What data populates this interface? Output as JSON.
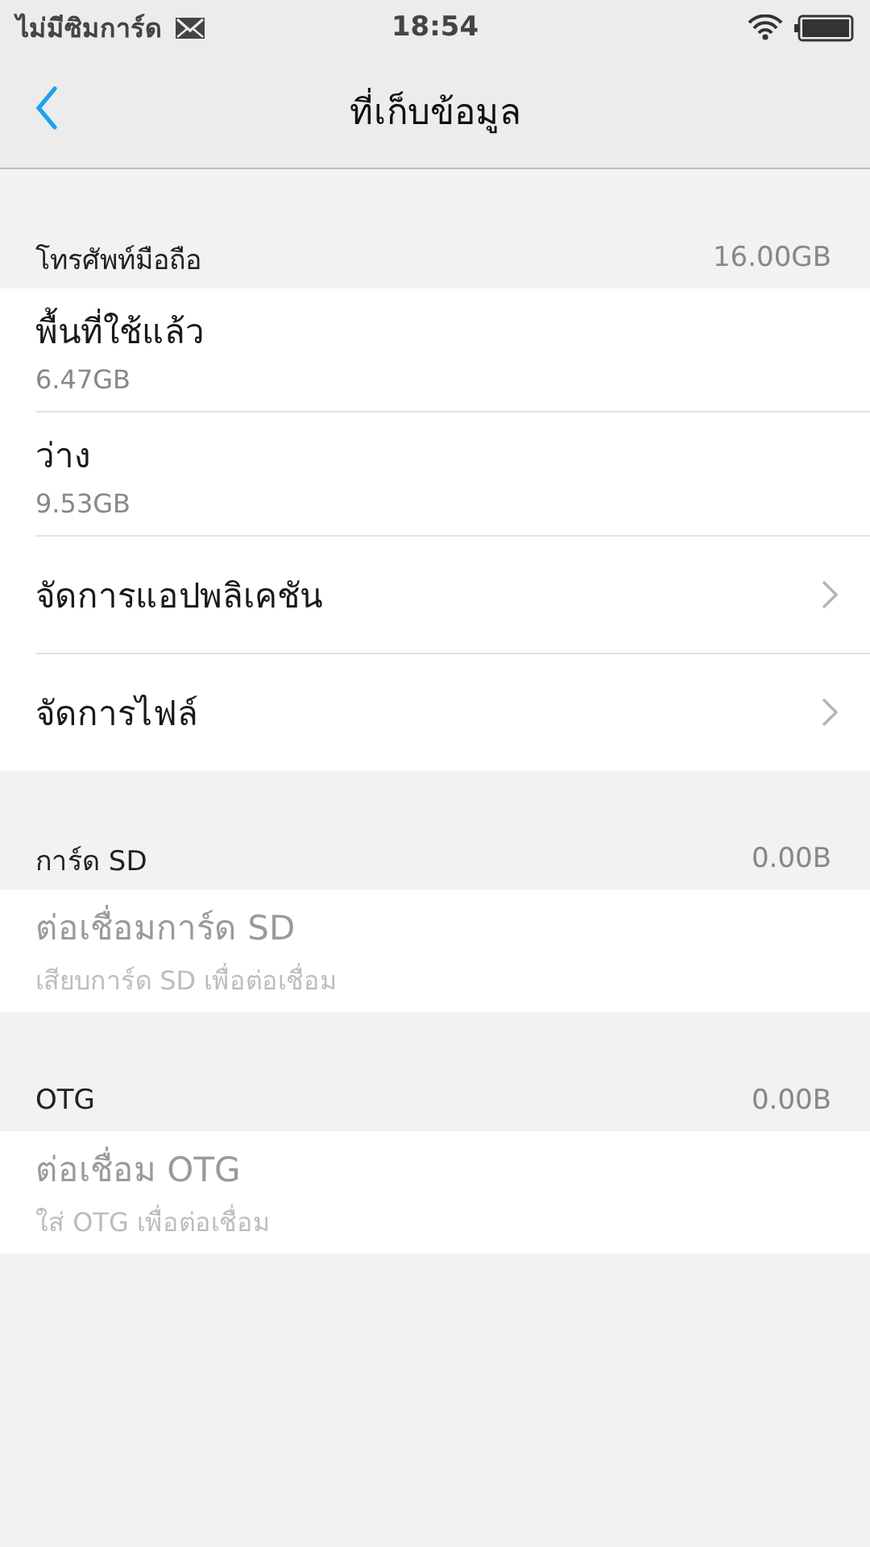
{
  "status_bar": {
    "carrier": "ไม่มีซิมการ์ด",
    "time": "18:54"
  },
  "header": {
    "title": "ที่เก็บข้อมูล"
  },
  "sections": [
    {
      "title": "โทรศัพท์มือถือ",
      "value": "16.00GB",
      "items": [
        {
          "kind": "info",
          "title": "พื้นที่ใช้แล้ว",
          "subtitle": "6.47GB",
          "disabled": false
        },
        {
          "kind": "info",
          "title": "ว่าง",
          "subtitle": "9.53GB",
          "disabled": false
        },
        {
          "kind": "link",
          "title": "จัดการแอปพลิเคชัน",
          "disabled": false
        },
        {
          "kind": "link",
          "title": "จัดการไฟล์",
          "disabled": false
        }
      ]
    },
    {
      "title": "การ์ด SD",
      "value": "0.00B",
      "items": [
        {
          "kind": "info",
          "title": "ต่อเชื่อมการ์ด SD",
          "subtitle": "เสียบการ์ด SD เพื่อต่อเชื่อม",
          "disabled": true
        }
      ]
    },
    {
      "title": "OTG",
      "value": "0.00B",
      "items": [
        {
          "kind": "info",
          "title": "ต่อเชื่อม OTG",
          "subtitle": "ใส่ OTG เพื่อต่อเชื่อม",
          "disabled": true
        }
      ]
    }
  ]
}
